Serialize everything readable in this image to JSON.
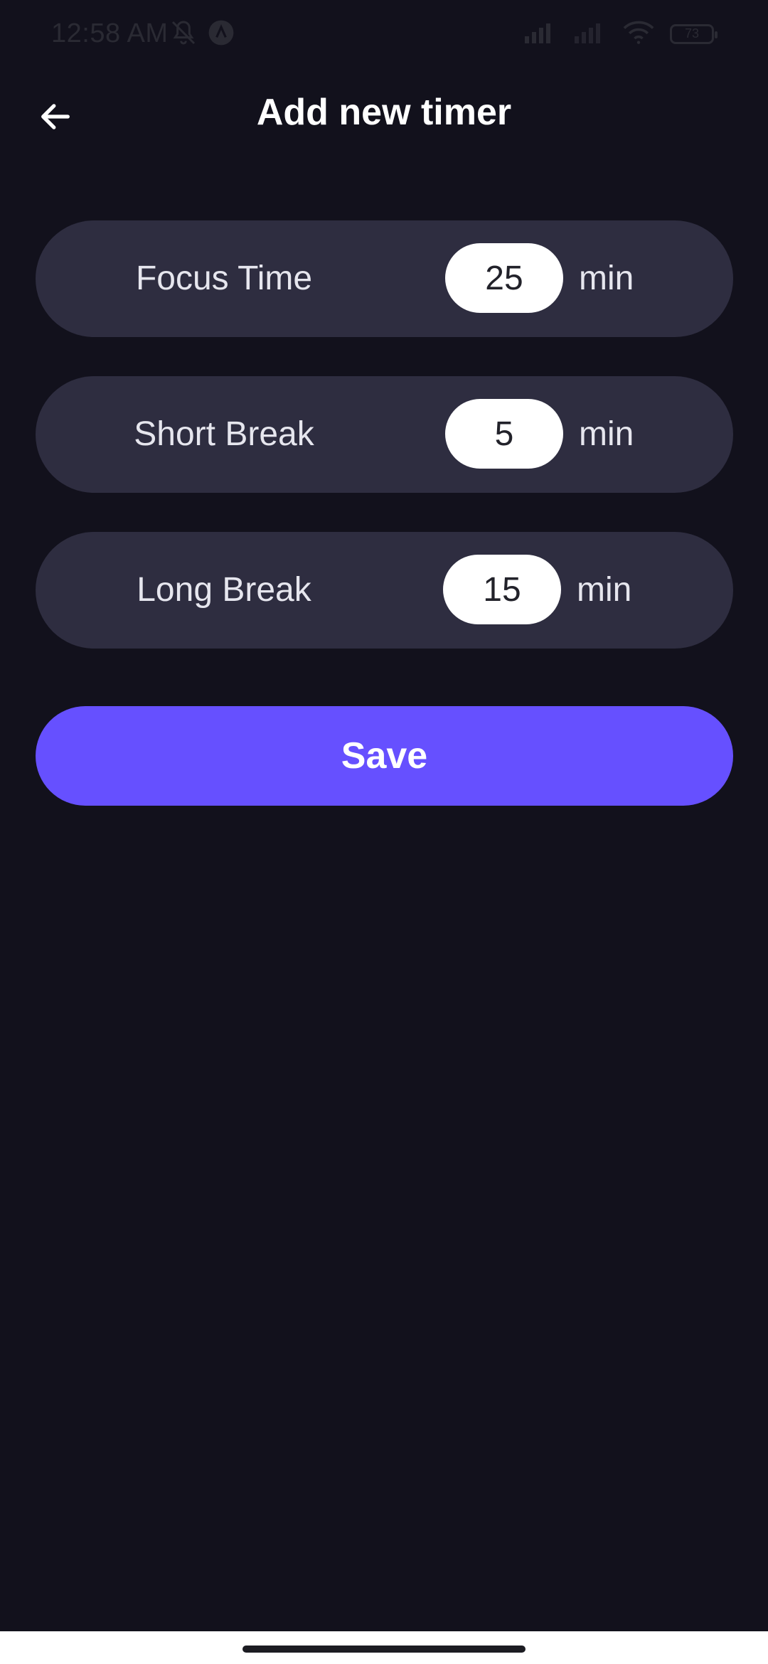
{
  "status_bar": {
    "time": "12:58 AM",
    "battery_level": "73",
    "icons": [
      "bell-off-icon",
      "app-badge-icon",
      "signal-icon",
      "signal-weak-icon",
      "wifi-icon",
      "battery-icon"
    ]
  },
  "header": {
    "title": "Add new timer",
    "back_icon": "arrow-left-icon"
  },
  "timers": [
    {
      "label": "Focus Time",
      "value": "25",
      "unit": "min"
    },
    {
      "label": "Short Break",
      "value": "5",
      "unit": "min"
    },
    {
      "label": "Long Break",
      "value": "15",
      "unit": "min"
    }
  ],
  "save_label": "Save",
  "colors": {
    "background": "#12111c",
    "row_background": "#2e2d40",
    "accent": "#6650ff",
    "input_background": "#ffffff"
  }
}
